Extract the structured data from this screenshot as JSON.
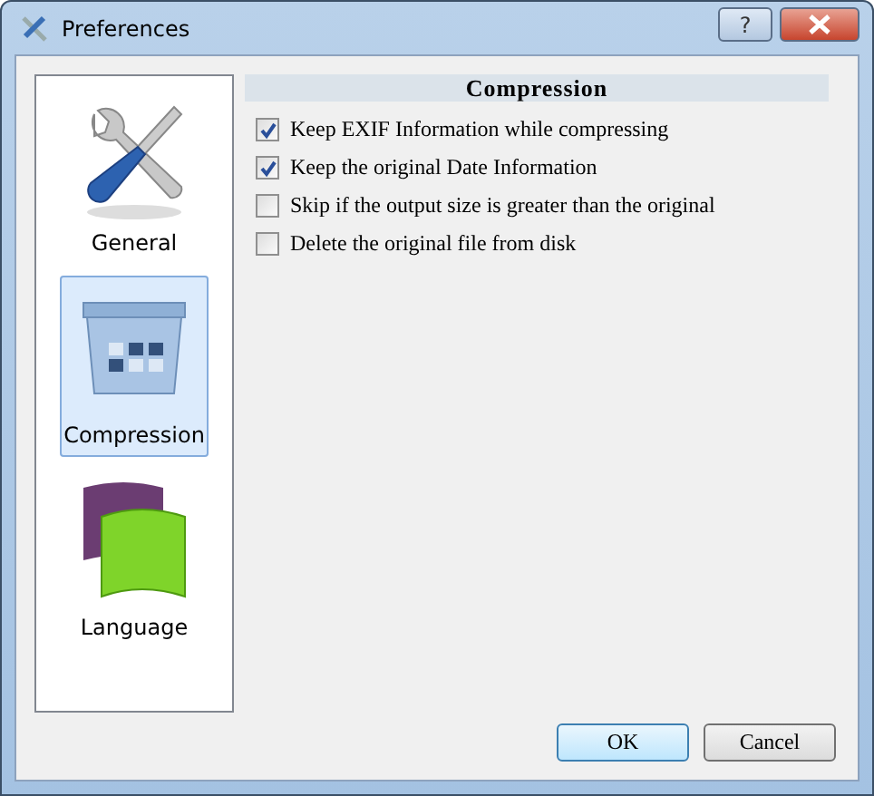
{
  "window": {
    "title": "Preferences",
    "help_button": "?"
  },
  "sidebar": {
    "items": [
      {
        "label": "General",
        "kind": "tools",
        "selected": false
      },
      {
        "label": "Compression",
        "kind": "compression",
        "selected": true
      },
      {
        "label": "Language",
        "kind": "flags",
        "selected": false
      }
    ]
  },
  "section": {
    "title": "Compression",
    "options": [
      {
        "label": "Keep EXIF Information while compressing",
        "checked": true
      },
      {
        "label": "Keep the original Date Information",
        "checked": true
      },
      {
        "label": "Skip if the output size is greater than the original",
        "checked": false
      },
      {
        "label": "Delete the original file from disk",
        "checked": false
      }
    ]
  },
  "buttons": [
    {
      "label": "OK",
      "default": true
    },
    {
      "label": "Cancel",
      "default": false
    }
  ]
}
